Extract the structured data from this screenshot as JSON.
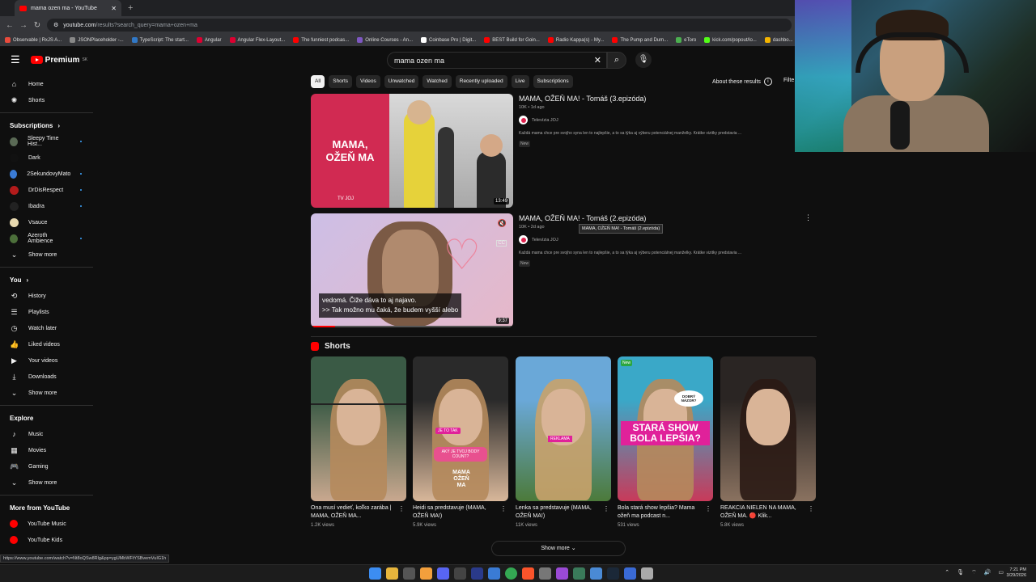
{
  "browser": {
    "tab_title": "mama ozen ma - YouTube",
    "new_tab": "+",
    "url_host": "youtube.com",
    "url_path": "/results?search_query=mama+ozen+ma",
    "bookmarks": [
      "Observable | RxJS A...",
      "JSONPlaceholder -...",
      "TypeScript: The start...",
      "Angular",
      "Angular Flex-Layout...",
      "The funniest podcas...",
      "Online Courses - An...",
      "Coinbase Pro | Digit...",
      "BEST Build for Goin...",
      "Radio Kappa(s) - My...",
      "The Pump and Dum...",
      "eToro",
      "kick.com/popout/lo...",
      "dashbo..."
    ],
    "status_url": "https://www.youtube.com/watch?v=Nt8oQSw8Rlg&pp=ygUMbWFtYSBvemVuIG1h"
  },
  "masthead": {
    "logo_text": "Premium",
    "logo_sup": "SK",
    "search_value": "mama ozen ma"
  },
  "sidebar": {
    "top": [
      {
        "label": "Home",
        "icon": "home-icon",
        "glyph": "⌂"
      },
      {
        "label": "Shorts",
        "icon": "shorts-icon",
        "glyph": "✺"
      }
    ],
    "subscriptions_title": "Subscriptions",
    "subscriptions": [
      {
        "label": "Sleepy Time Hist...",
        "color": "#5a6a55",
        "dot": true
      },
      {
        "label": "Dark",
        "color": "#111111",
        "dot": false
      },
      {
        "label": "2SekundovyMato",
        "color": "#3a7bd5",
        "dot": true
      },
      {
        "label": "DrDisRespect",
        "color": "#b31b1b",
        "dot": true
      },
      {
        "label": "Ibadra",
        "color": "#222222",
        "dot": true
      },
      {
        "label": "Vsauce",
        "color": "#e8d9b0",
        "dot": false
      },
      {
        "label": "Azeroth Ambience",
        "color": "#4c6f3a",
        "dot": true
      }
    ],
    "subs_show_more": "Show more",
    "you_title": "You",
    "you_items": [
      {
        "label": "History",
        "icon": "history-icon",
        "glyph": "⟲"
      },
      {
        "label": "Playlists",
        "icon": "playlists-icon",
        "glyph": "☰"
      },
      {
        "label": "Watch later",
        "icon": "watch-later-icon",
        "glyph": "◷"
      },
      {
        "label": "Liked videos",
        "icon": "thumbs-up-icon",
        "glyph": "👍"
      },
      {
        "label": "Your videos",
        "icon": "your-videos-icon",
        "glyph": "▶"
      },
      {
        "label": "Downloads",
        "icon": "download-icon",
        "glyph": "⤓"
      }
    ],
    "you_show_more": "Show more",
    "explore_title": "Explore",
    "explore_items": [
      {
        "label": "Music",
        "icon": "music-icon",
        "glyph": "♪"
      },
      {
        "label": "Movies",
        "icon": "movies-icon",
        "glyph": "▦"
      },
      {
        "label": "Gaming",
        "icon": "gaming-icon",
        "glyph": "🎮"
      }
    ],
    "explore_show_more": "Show more",
    "more_title": "More from YouTube",
    "more_items": [
      {
        "label": "YouTube Music",
        "icon": "youtube-music-icon"
      },
      {
        "label": "YouTube Kids",
        "icon": "youtube-kids-icon"
      }
    ]
  },
  "chips": [
    "All",
    "Shorts",
    "Videos",
    "Unwatched",
    "Watched",
    "Recently uploaded",
    "Live",
    "Subscriptions"
  ],
  "about_results": "About these results",
  "filters": "Filte",
  "videos": [
    {
      "title": "MAMA, OŽEŇ MA! - Tomáš (3.epizóda)",
      "meta": "10K • 1d ago",
      "channel": "Televízia JOJ",
      "desc": "Každá mama chce pre svojho syna len to najlepšie, a to sa týka aj výberu potenciálnej manželky. Krátke vizitky predstavia ...",
      "badge": "New",
      "duration": "13:49",
      "thumb_text": "MAMA,\nOŽEŇ MA",
      "thumb_logo": "TV JOJ"
    },
    {
      "title": "MAMA, OŽEŇ MA! - Tomáš (2.epizóda)",
      "meta": "10K • 2d ago",
      "channel": "Televízia JOJ",
      "desc": "Každá mama chce pre svojho syna len to najlepšie, a to sa týka aj výberu potenciálnej manželky. Krátke vizitky predstavia ...",
      "badge": "New",
      "duration": "9:37",
      "subtitle1": "vedomá. Čiže dáva to aj najavo.",
      "subtitle2": ">> Tak možno mu čaká, že budem vyšší alebo",
      "tooltip": "MAMA, OŽEŇ MA! - Tomáš (2.epizóda)"
    }
  ],
  "shorts_title": "Shorts",
  "shorts": [
    {
      "title": "Ona musí vedieť, koľko zarába | MAMA, OŽEŇ MA...",
      "views": "1.2K views",
      "c1": "#3a5a45",
      "c2": "#c9a88f",
      "overlay": ""
    },
    {
      "title": "Heidi sa predstavuje (MAMA, OŽEŇ MA!)",
      "views": "5.9K views",
      "c1": "#2a2a2a",
      "c2": "#d8b79a",
      "overlay": "JE TO TAK",
      "overlay2": "AKÝ JE TVOJ BODY COUNT?",
      "overlay3": "MAMA OŽEŇ MA"
    },
    {
      "title": "Lenka sa predstavuje (MAMA, OŽEŇ MA!)",
      "views": "11K views",
      "c1": "#6aa8d8",
      "c2": "#4c7a3a",
      "overlay": "REKLAMA"
    },
    {
      "title": "Bola stará show lepšia? Mama ožeň ma podcast n...",
      "views": "531 views",
      "c1": "#3aa8c8",
      "c2": "#c83a5a",
      "overlay": "STARÁ SHOW BOLA LEPŠIA?",
      "badge": "New",
      "bubble": "DOBRÝ NÁZOR?"
    },
    {
      "title": "REAKCIA NIELEN NA MAMA, OŽEŇ MA. 🔴 Klik...",
      "views": "5.8K views",
      "c1": "#2a2523",
      "c2": "#8a7260",
      "overlay": ""
    }
  ],
  "show_more": "Show more",
  "taskbar": {
    "time": "7:21 PM",
    "date": "3/29/2026",
    "icons": [
      "windows-icon",
      "file-explorer-icon",
      "store-icon",
      "app-icon",
      "discord-icon",
      "app-icon",
      "photoshop-icon",
      "app-icon",
      "chrome-icon",
      "brave-icon",
      "app-icon",
      "app-icon",
      "app-icon",
      "app-icon",
      "steam-icon",
      "app-icon",
      "app-icon"
    ],
    "icon_colors": [
      "#3c8df2",
      "#e7b53c",
      "#555",
      "#f29f3c",
      "#5865f2",
      "#444",
      "#2a3a8a",
      "#3a7bd5",
      "#34a853",
      "#fb542b",
      "#777",
      "#9a4ad5",
      "#3a7a5a",
      "#4a8ad5",
      "#1b2838",
      "#3a6ad5",
      "#aaa"
    ]
  }
}
